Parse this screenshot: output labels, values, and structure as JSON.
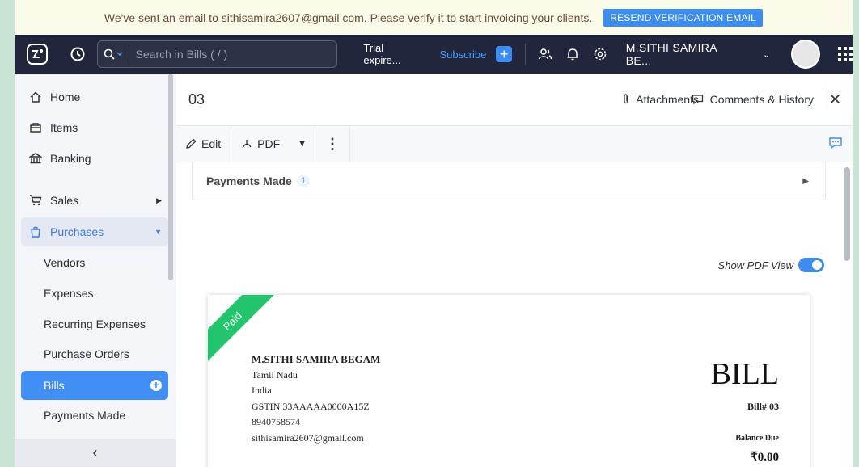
{
  "banner": {
    "message": "We've sent an email to sithisamira2607@gmail.com. Please verify it to start invoicing your clients.",
    "button": "RESEND VERIFICATION EMAIL"
  },
  "topbar": {
    "search_placeholder": "Search in Bills ( / )",
    "trial": "Trial expire...",
    "subscribe": "Subscribe",
    "org": "M.SITHI SAMIRA BE..."
  },
  "sidebar": {
    "items": [
      {
        "label": "Home",
        "icon": "home-icon"
      },
      {
        "label": "Items",
        "icon": "items-icon"
      },
      {
        "label": "Banking",
        "icon": "bank-icon"
      },
      {
        "label": "Sales",
        "icon": "cart-icon"
      },
      {
        "label": "Purchases",
        "icon": "bag-icon"
      },
      {
        "label": "Vendors"
      },
      {
        "label": "Expenses"
      },
      {
        "label": "Recurring Expenses"
      },
      {
        "label": "Purchase Orders"
      },
      {
        "label": "Bills"
      },
      {
        "label": "Payments Made"
      }
    ]
  },
  "bill": {
    "number": "03",
    "attachments": "Attachments",
    "comments": "Comments & History",
    "toolbar": {
      "edit": "Edit",
      "pdf": "PDF"
    },
    "payments_made": {
      "label": "Payments Made",
      "count": "1"
    },
    "show_pdf_view": "Show PDF View",
    "doc": {
      "status": "Paid",
      "from_name": "M.SITHI SAMIRA BEGAM",
      "state": "Tamil Nadu",
      "country": "India",
      "gstin": "GSTIN 33AAAAA0000A15Z",
      "phone": "8940758574",
      "email": "sithisamira2607@gmail.com",
      "title": "BILL",
      "bill_no": "Bill# 03",
      "balance_due_label": "Balance Due",
      "balance_due": "₹0.00"
    }
  },
  "colors": {
    "topbar": "#21263c",
    "accent": "#418ef4",
    "paid": "#22c56c"
  }
}
